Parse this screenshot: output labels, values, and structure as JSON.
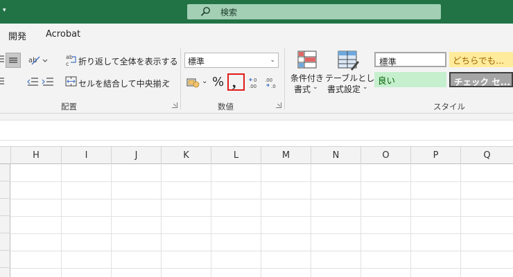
{
  "search": {
    "label": "検索"
  },
  "menu": {
    "tabs": [
      "開発",
      "Acrobat"
    ]
  },
  "ribbon": {
    "alignment": {
      "wrap_text": "折り返して全体を表示する",
      "merge_center": "セルを結合して中央揃え",
      "group_label": "配置"
    },
    "number": {
      "format_value": "標準",
      "percent": "%",
      "comma": ",",
      "group_label": "数値"
    },
    "styles": {
      "conditional_formatting_line1": "条件付き",
      "conditional_formatting_line2": "書式",
      "format_as_table_line1": "テーブルとして",
      "format_as_table_line2": "書式設定",
      "cell_styles": [
        {
          "label": "標準",
          "bg": "#ffffff",
          "color": "#262626"
        },
        {
          "label": "どちらでも...",
          "bg": "#ffeb9c",
          "color": "#9c6500"
        },
        {
          "label": "良い",
          "bg": "#c6efce",
          "color": "#006100"
        },
        {
          "label": "チェック セ...",
          "bg": "#a5a5a5",
          "color": "#ffffff"
        }
      ],
      "group_label": "スタイル"
    }
  },
  "grid": {
    "columns": [
      "H",
      "I",
      "J",
      "K",
      "L",
      "M",
      "N",
      "O",
      "P",
      "Q"
    ]
  },
  "colors": {
    "title_bar": "#217346",
    "highlight": "#e21a1a"
  }
}
